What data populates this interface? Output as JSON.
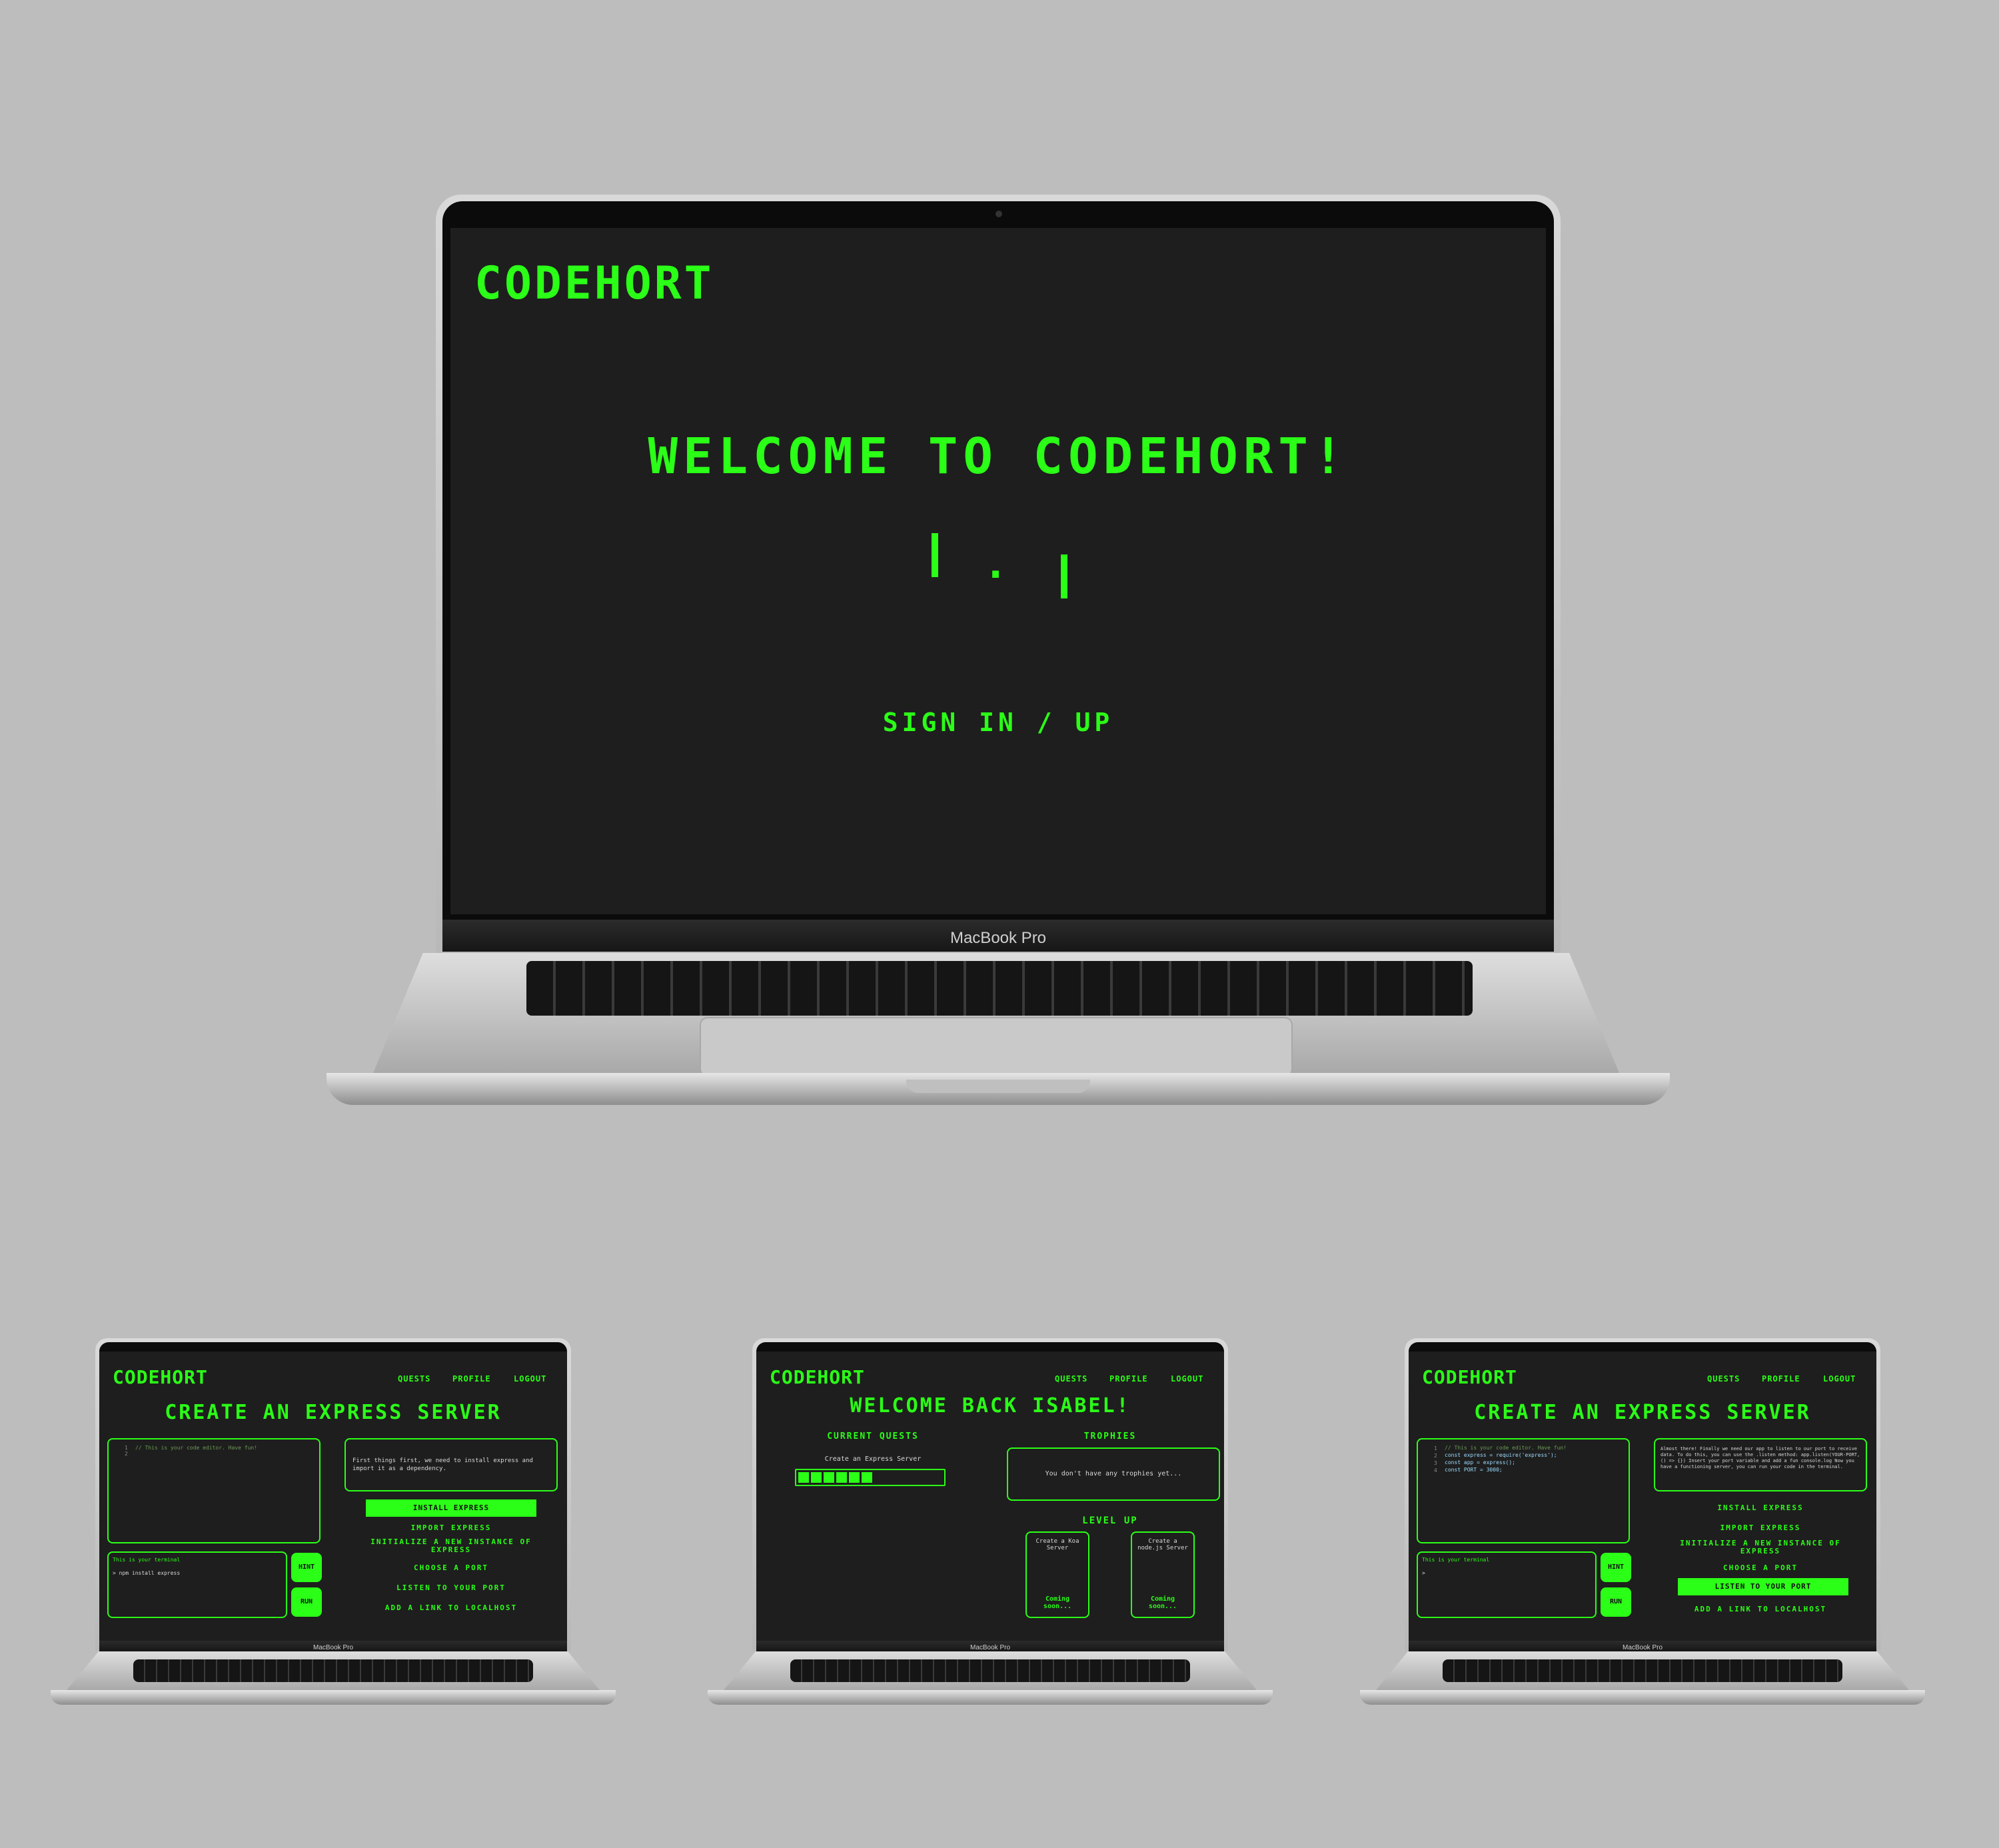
{
  "main_laptop": {
    "brand": "CODEHORT",
    "welcome": "WELCOME TO CODEHORT!",
    "loading_dot": ".",
    "signin": "SIGN IN / UP",
    "model_label": "MacBook Pro"
  },
  "quest_laptop_1": {
    "brand": "CODEHORT",
    "nav": [
      "QUESTS",
      "PROFILE",
      "LOGOUT"
    ],
    "title": "CREATE AN EXPRESS SERVER",
    "editor_line1": "// This is your code editor. Have fun!",
    "instructions": "First things first, we need to install express and import it as a dependency.",
    "terminal_label": "This is your terminal",
    "terminal_cmd": "> npm install express",
    "hint": "HINT",
    "run": "RUN",
    "steps": [
      "INSTALL EXPRESS",
      "IMPORT EXPRESS",
      "INITIALIZE A NEW INSTANCE OF EXPRESS",
      "CHOOSE A PORT",
      "LISTEN TO YOUR PORT",
      "ADD A LINK TO LOCALHOST"
    ],
    "active_step": 0,
    "model_label": "MacBook Pro"
  },
  "dashboard_laptop": {
    "brand": "CODEHORT",
    "nav": [
      "QUESTS",
      "PROFILE",
      "LOGOUT"
    ],
    "title": "WELCOME BACK ISABEL!",
    "current_quests": "CURRENT QUESTS",
    "quest_name": "Create an Express Server",
    "progress_blocks_filled": 6,
    "trophies": "TROPHIES",
    "trophies_empty": "You don't have any trophies yet...",
    "level_up": "LEVEL UP",
    "card1": "Create a Koa Server",
    "card2": "Create a node.js Server",
    "coming": "Coming soon...",
    "model_label": "MacBook Pro"
  },
  "quest_laptop_2": {
    "brand": "CODEHORT",
    "nav": [
      "QUESTS",
      "PROFILE",
      "LOGOUT"
    ],
    "title": "CREATE AN EXPRESS SERVER",
    "code_lines": [
      "// This is your code editor. Have fun!",
      "const express = require('express');",
      "const app = express();",
      "const PORT = 3000;"
    ],
    "instructions": "Almost there! Finally we need our app to listen to our port to receive data. To do this, you can use the .listen method: app.listen(YOUR-PORT, () => {}) Insert your port variable and add a fun console.log Now you have a functioning server, you can run your code in the terminal.",
    "terminal_label": "This is your terminal",
    "terminal_cmd": ">",
    "hint": "HINT",
    "run": "RUN",
    "steps": [
      "INSTALL EXPRESS",
      "IMPORT EXPRESS",
      "INITIALIZE A NEW INSTANCE OF EXPRESS",
      "CHOOSE A PORT",
      "LISTEN TO YOUR PORT",
      "ADD A LINK TO LOCALHOST"
    ],
    "active_step": 4,
    "model_label": "MacBook Pro"
  },
  "colors": {
    "background": "#bdbdbd",
    "screen": "#1e1e1e",
    "accent_green": "#2bff17"
  }
}
